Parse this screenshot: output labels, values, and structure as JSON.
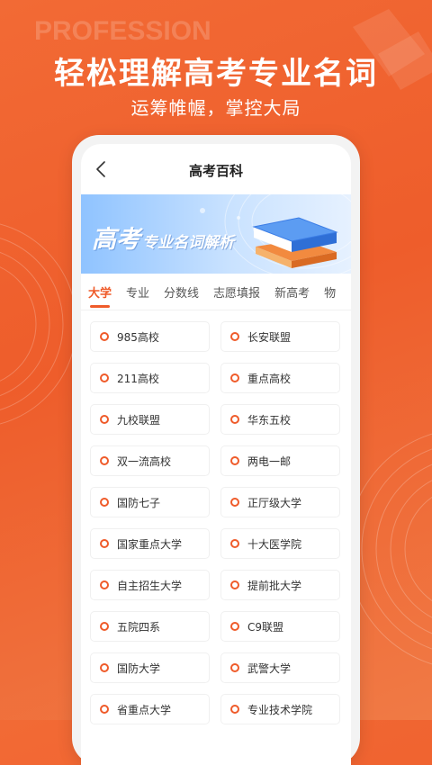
{
  "hero": {
    "ghost_text": "PROFESSION",
    "headline": "轻松理解高考专业名词",
    "subline": "运筹帷幄，掌控大局"
  },
  "nav": {
    "title": "高考百科"
  },
  "banner": {
    "title_big": "高考",
    "title_rest": "专业名词解析"
  },
  "tabs": [
    {
      "label": "大学",
      "active": true
    },
    {
      "label": "专业",
      "active": false
    },
    {
      "label": "分数线",
      "active": false
    },
    {
      "label": "志愿填报",
      "active": false
    },
    {
      "label": "新高考",
      "active": false
    },
    {
      "label": "物",
      "active": false
    }
  ],
  "terms": [
    "985高校",
    "长安联盟",
    "211高校",
    "重点高校",
    "九校联盟",
    "华东五校",
    "双一流高校",
    "两电一邮",
    "国防七子",
    "正厅级大学",
    "国家重点大学",
    "十大医学院",
    "自主招生大学",
    "提前批大学",
    "五院四系",
    "C9联盟",
    "国防大学",
    "武警大学",
    "省重点大学",
    "专业技术学院"
  ],
  "colors": {
    "accent": "#ef5b2a",
    "background": "#ee5d2b",
    "banner": "#8fc3ff"
  }
}
